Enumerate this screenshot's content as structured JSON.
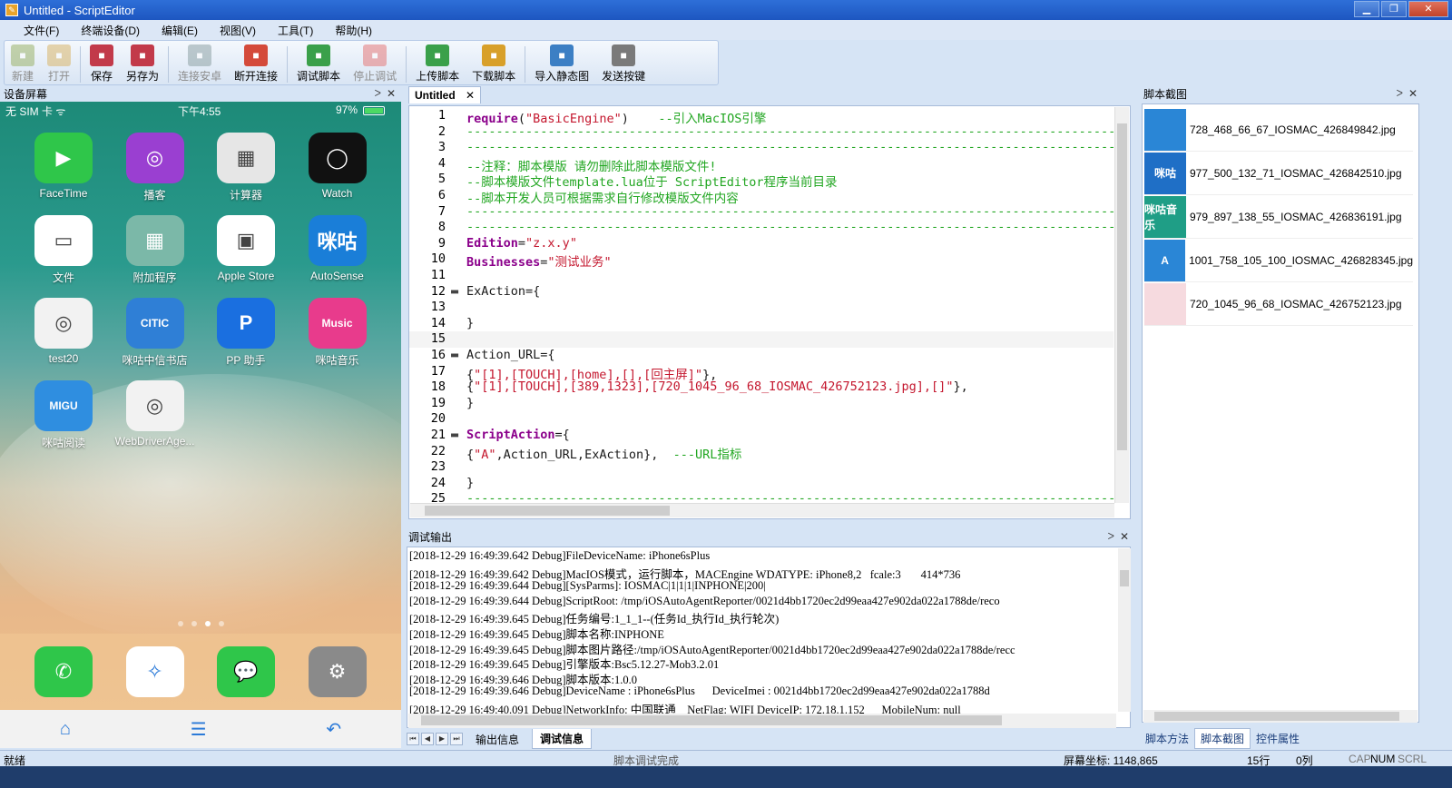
{
  "window": {
    "title": "Untitled - ScriptEditor",
    "min": "▁",
    "restore": "❐",
    "close": "✕"
  },
  "menu": [
    "文件(F)",
    "终端设备(D)",
    "编辑(E)",
    "视图(V)",
    "工具(T)",
    "帮助(H)"
  ],
  "toolbar": [
    {
      "label": "新建",
      "icon": "new-icon",
      "color": "#9bb36a",
      "enabled": false
    },
    {
      "label": "打开",
      "icon": "open-icon",
      "color": "#d9b66b",
      "enabled": false
    },
    {
      "label": "保存",
      "icon": "save-icon",
      "color": "#c23a4a",
      "enabled": true
    },
    {
      "label": "另存为",
      "icon": "save-as-icon",
      "color": "#c23a4a",
      "enabled": true
    },
    {
      "label": "连接安卓",
      "icon": "connect-android-icon",
      "color": "#8fa3a6",
      "enabled": false
    },
    {
      "label": "断开连接",
      "icon": "disconnect-icon",
      "color": "#d44a3a",
      "enabled": true
    },
    {
      "label": "调试脚本",
      "icon": "debug-icon",
      "color": "#3aa04a",
      "enabled": true
    },
    {
      "label": "停止调试",
      "icon": "stop-debug-icon",
      "color": "#e57a7a",
      "enabled": false
    },
    {
      "label": "上传脚本",
      "icon": "upload-icon",
      "color": "#3aa04a",
      "enabled": true
    },
    {
      "label": "下载脚本",
      "icon": "download-icon",
      "color": "#d8a02a",
      "enabled": true
    },
    {
      "label": "导入静态图",
      "icon": "import-image-icon",
      "color": "#3c7fc4",
      "enabled": true
    },
    {
      "label": "发送按键",
      "icon": "send-key-icon",
      "color": "#7a7a7a",
      "enabled": true
    }
  ],
  "device_panel": {
    "title": "设备屏幕",
    "pin": "ᐳ",
    "close": "✕"
  },
  "phone": {
    "carrier": "无 SIM 卡 ᯤ",
    "time": "下午4:55",
    "battery": "97%",
    "apps": [
      {
        "name": "FaceTime",
        "color": "#2fc64a",
        "glyph": "▶"
      },
      {
        "name": "播客",
        "color": "#9a3fd1",
        "glyph": "◎"
      },
      {
        "name": "计算器",
        "color": "#e6e6e6",
        "glyph": "▦"
      },
      {
        "name": "Watch",
        "color": "#111111",
        "glyph": "◯"
      },
      {
        "name": "文件",
        "color": "#ffffff",
        "glyph": "▭"
      },
      {
        "name": "附加程序",
        "color": "#7bb8a8",
        "glyph": "▦"
      },
      {
        "name": "Apple Store",
        "color": "#ffffff",
        "glyph": "▣"
      },
      {
        "name": "AutoSense",
        "color": "#1a7ed8",
        "glyph": "咪咕"
      },
      {
        "name": "test20",
        "color": "#f2f2f2",
        "glyph": "◎"
      },
      {
        "name": "咪咕中信书店",
        "color": "#2f7fd6",
        "glyph": "CITIC"
      },
      {
        "name": "PP 助手",
        "color": "#1a6fe0",
        "glyph": "P"
      },
      {
        "name": "咪咕音乐",
        "color": "#e83b8c",
        "glyph": "Music"
      },
      {
        "name": "咪咕阅读",
        "color": "#2f8ee0",
        "glyph": "MIGU"
      },
      {
        "name": "WebDriverAge...",
        "color": "#f2f2f2",
        "glyph": "◎"
      }
    ],
    "dock": [
      {
        "name": "phone",
        "color": "#2fc64a",
        "glyph": "✆"
      },
      {
        "name": "safari",
        "color": "#ffffff",
        "glyph": "✧"
      },
      {
        "name": "messages",
        "color": "#2fc64a",
        "glyph": "💬"
      },
      {
        "name": "settings",
        "color": "#8a8a8a",
        "glyph": "⚙"
      }
    ],
    "nav": {
      "home": "⌂",
      "menu": "☰",
      "back": "↶"
    }
  },
  "editor": {
    "tab": "Untitled",
    "tab_close": "✕",
    "lines": [
      {
        "n": "1",
        "fold": "",
        "segs": [
          {
            "t": "require",
            "c": "kw"
          },
          {
            "t": "(",
            "c": "plain"
          },
          {
            "t": "\"BasicEngine\"",
            "c": "str"
          },
          {
            "t": ")    ",
            "c": "plain"
          },
          {
            "t": "--引入MacIOS引擎",
            "c": "cmt"
          }
        ]
      },
      {
        "n": "2",
        "fold": "",
        "segs": [
          {
            "t": "--------------------------------------------------------------------------------------------------------",
            "c": "cmt"
          }
        ]
      },
      {
        "n": "3",
        "fold": "",
        "segs": [
          {
            "t": "--------------------------------------------------------------------------------------------------------",
            "c": "cmt"
          }
        ]
      },
      {
        "n": "4",
        "fold": "",
        "segs": [
          {
            "t": "--注释：脚本模版 请勿删除此脚本模版文件!",
            "c": "cmt"
          }
        ]
      },
      {
        "n": "5",
        "fold": "",
        "segs": [
          {
            "t": "--脚本模版文件template.lua位于 ScriptEditor程序当前目录",
            "c": "cmt"
          }
        ]
      },
      {
        "n": "6",
        "fold": "",
        "segs": [
          {
            "t": "--脚本开发人员可根据需求自行修改模版文件内容",
            "c": "cmt"
          }
        ]
      },
      {
        "n": "7",
        "fold": "",
        "segs": [
          {
            "t": "--------------------------------------------------------------------------------------------------------",
            "c": "cmt"
          }
        ]
      },
      {
        "n": "8",
        "fold": "",
        "segs": [
          {
            "t": "--------------------------------------------------------------------------------------------------------",
            "c": "cmt"
          }
        ]
      },
      {
        "n": "9",
        "fold": "",
        "segs": [
          {
            "t": "Edition",
            "c": "kw"
          },
          {
            "t": "=",
            "c": "plain"
          },
          {
            "t": "\"z.x.y\"",
            "c": "str"
          }
        ]
      },
      {
        "n": "10",
        "fold": "",
        "segs": [
          {
            "t": "Businesses",
            "c": "kw"
          },
          {
            "t": "=",
            "c": "plain"
          },
          {
            "t": "\"测试业务\"",
            "c": "str"
          }
        ]
      },
      {
        "n": "11",
        "fold": "",
        "segs": []
      },
      {
        "n": "12",
        "fold": "▬",
        "segs": [
          {
            "t": "ExAction={",
            "c": "plain"
          }
        ]
      },
      {
        "n": "13",
        "fold": "",
        "segs": []
      },
      {
        "n": "14",
        "fold": "",
        "segs": [
          {
            "t": "}",
            "c": "plain"
          }
        ]
      },
      {
        "n": "15",
        "fold": "",
        "segs": []
      },
      {
        "n": "16",
        "fold": "▬",
        "segs": [
          {
            "t": "Action_URL={",
            "c": "plain"
          }
        ]
      },
      {
        "n": "17",
        "fold": "",
        "segs": [
          {
            "t": "{",
            "c": "plain"
          },
          {
            "t": "\"[1],[TOUCH],[home],[],[回主屏]\"",
            "c": "str"
          },
          {
            "t": "},",
            "c": "plain"
          }
        ]
      },
      {
        "n": "18",
        "fold": "",
        "segs": [
          {
            "t": "{",
            "c": "plain"
          },
          {
            "t": "\"[1],[TOUCH],[389,1323],[720_1045_96_68_IOSMAC_426752123.jpg],[]\"",
            "c": "str"
          },
          {
            "t": "},",
            "c": "plain"
          }
        ]
      },
      {
        "n": "19",
        "fold": "",
        "segs": [
          {
            "t": "}",
            "c": "plain"
          }
        ]
      },
      {
        "n": "20",
        "fold": "",
        "segs": []
      },
      {
        "n": "21",
        "fold": "▬",
        "segs": [
          {
            "t": "ScriptAction",
            "c": "kw"
          },
          {
            "t": "={",
            "c": "plain"
          }
        ]
      },
      {
        "n": "22",
        "fold": "",
        "segs": [
          {
            "t": "{",
            "c": "plain"
          },
          {
            "t": "\"A\"",
            "c": "str"
          },
          {
            "t": ",Action_URL,ExAction},  ",
            "c": "plain"
          },
          {
            "t": "---URL指标",
            "c": "cmt"
          }
        ]
      },
      {
        "n": "23",
        "fold": "",
        "segs": []
      },
      {
        "n": "24",
        "fold": "",
        "segs": [
          {
            "t": "}",
            "c": "plain"
          }
        ]
      },
      {
        "n": "25",
        "fold": "",
        "segs": [
          {
            "t": "--------------------------------------------------------------------------------------------------------",
            "c": "cmt"
          }
        ]
      }
    ],
    "current_line": 15
  },
  "debug_panel": {
    "title": "调试输出",
    "lines": [
      "[2018-12-29 16:49:39.642 Debug]FileDeviceName: iPhone6sPlus",
      "[2018-12-29 16:49:39.642 Debug]MacIOS模式，运行脚本，MACEngine WDATYPE: iPhone8,2   fcale:3       414*736",
      "[2018-12-29 16:49:39.644 Debug][SysParms]: IOSMAC|1|1|1|INPHONE|200|",
      "[2018-12-29 16:49:39.644 Debug]ScriptRoot: /tmp/iOSAutoAgentReporter/0021d4bb1720ec2d99eaa427e902da022a1788de/reco",
      "[2018-12-29 16:49:39.645 Debug]任务编号:1_1_1--(任务Id_执行Id_执行轮次)",
      "[2018-12-29 16:49:39.645 Debug]脚本名称:INPHONE",
      "[2018-12-29 16:49:39.645 Debug]脚本图片路径:/tmp/iOSAutoAgentReporter/0021d4bb1720ec2d99eaa427e902da022a1788de/recc",
      "[2018-12-29 16:49:39.645 Debug]引擎版本:Bsc5.12.27-Mob3.2.01",
      "[2018-12-29 16:49:39.646 Debug]脚本版本:1.0.0",
      "[2018-12-29 16:49:39.646 Debug]DeviceName : iPhone6sPlus      DeviceImei : 0021d4bb1720ec2d99eaa427e902da022a1788d",
      "[2018-12-29 16:49:40.091 Debug]NetworkInfo: 中国联通    NetFlag: WIFI DeviceIP: 172.18.1.152      MobileNum: null"
    ],
    "tabs": [
      "输出信息",
      "调试信息"
    ],
    "active_tab": 1
  },
  "shots_panel": {
    "title": "脚本截图",
    "items": [
      {
        "name": "728_468_66_67_IOSMAC_426849842.jpg",
        "color": "#2a86d6",
        "glyph": ""
      },
      {
        "name": "977_500_132_71_IOSMAC_426842510.jpg",
        "color": "#1f6fc6",
        "glyph": "咪咕"
      },
      {
        "name": "979_897_138_55_IOSMAC_426836191.jpg",
        "color": "#1f9e86",
        "glyph": "咪咕音乐"
      },
      {
        "name": "1001_758_105_100_IOSMAC_426828345.jpg",
        "color": "#2a86d6",
        "glyph": "A"
      },
      {
        "name": "720_1045_96_68_IOSMAC_426752123.jpg",
        "color": "#f6dadf",
        "glyph": ""
      }
    ],
    "tabs": [
      "脚本方法",
      "脚本截图",
      "控件属性"
    ],
    "active_tab": 1
  },
  "statusbar": {
    "ready": "就绪",
    "message": "脚本调试完成",
    "coords": "屏幕坐标: 1148,865",
    "row": "15行",
    "col": "0列",
    "cap": "CAP",
    "num": "NUM",
    "scrl": "SCRL"
  }
}
